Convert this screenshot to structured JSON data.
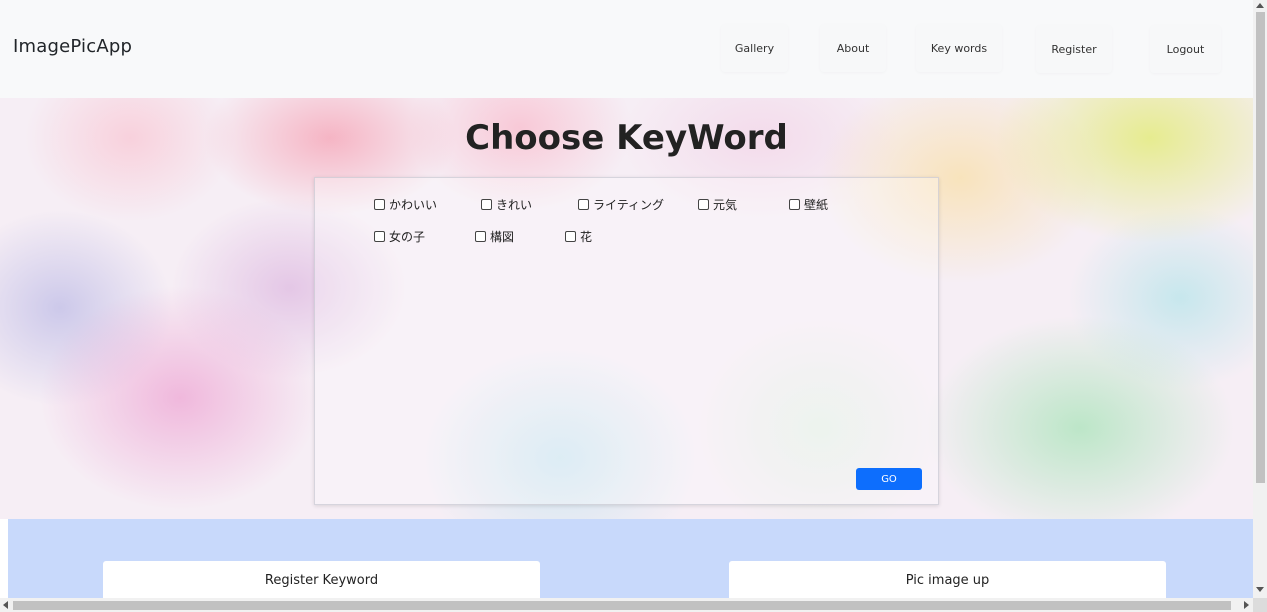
{
  "header": {
    "brand": "ImagePicApp",
    "nav": [
      {
        "label": "Gallery"
      },
      {
        "label": "About"
      },
      {
        "label": "Key words"
      },
      {
        "label": "Register"
      },
      {
        "label": "Logout"
      }
    ]
  },
  "hero": {
    "title": "Choose KeyWord",
    "keywords": [
      {
        "label": "かわいい",
        "checked": false
      },
      {
        "label": "きれい",
        "checked": false
      },
      {
        "label": "ライティング",
        "checked": false
      },
      {
        "label": "元気",
        "checked": false
      },
      {
        "label": "壁紙",
        "checked": false
      },
      {
        "label": "女の子",
        "checked": false
      },
      {
        "label": "構図",
        "checked": false
      },
      {
        "label": "花",
        "checked": false
      }
    ],
    "go_label": "GO"
  },
  "bottom": {
    "register_keyword_label": "Register Keyword",
    "pic_image_up_label": "Pic image up"
  },
  "colors": {
    "primary": "#0d6efd",
    "bottom_band": "#c8d9fb",
    "header_bg": "#f8f9fa"
  }
}
